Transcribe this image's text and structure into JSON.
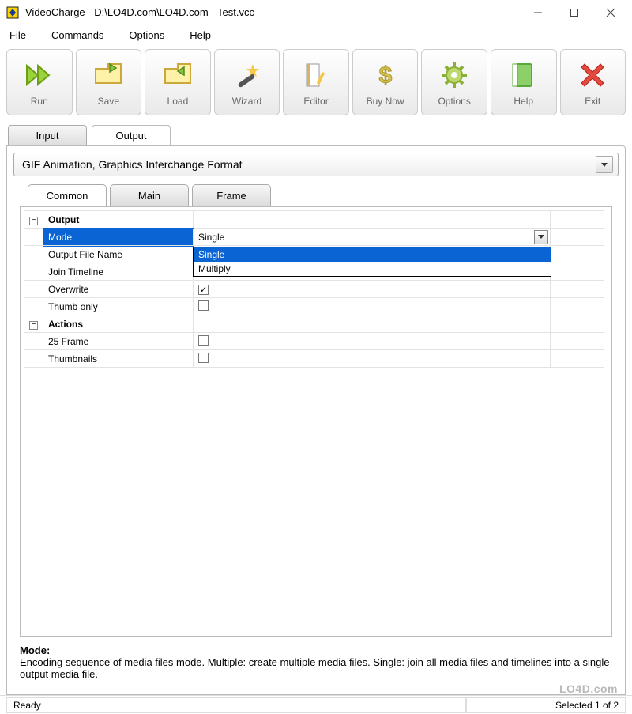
{
  "window": {
    "title": "VideoCharge - D:\\LO4D.com\\LO4D.com - Test.vcc"
  },
  "menubar": {
    "items": [
      "File",
      "Commands",
      "Options",
      "Help"
    ]
  },
  "toolbar": {
    "items": [
      {
        "name": "run",
        "label": "Run"
      },
      {
        "name": "save",
        "label": "Save"
      },
      {
        "name": "load",
        "label": "Load"
      },
      {
        "name": "wizard",
        "label": "Wizard"
      },
      {
        "name": "editor",
        "label": "Editor"
      },
      {
        "name": "buy-now",
        "label": "Buy Now"
      },
      {
        "name": "options",
        "label": "Options"
      },
      {
        "name": "help",
        "label": "Help"
      },
      {
        "name": "exit",
        "label": "Exit"
      }
    ]
  },
  "main_tabs": {
    "input": "Input",
    "output": "Output",
    "active": "output"
  },
  "format": {
    "value": "GIF Animation, Graphics Interchange Format"
  },
  "sub_tabs": {
    "common": "Common",
    "main": "Main",
    "frame": "Frame",
    "active": "common"
  },
  "grid": {
    "sections": [
      {
        "title": "Output",
        "rows": [
          {
            "key": "mode",
            "label": "Mode",
            "value": "Single",
            "type": "combo",
            "selected": true
          },
          {
            "key": "output-file-name",
            "label": "Output File Name",
            "value": "",
            "type": "text"
          },
          {
            "key": "join-timeline",
            "label": "Join Timeline",
            "value": "",
            "type": "text"
          },
          {
            "key": "overwrite",
            "label": "Overwrite",
            "checked": true,
            "type": "checkbox"
          },
          {
            "key": "thumb-only",
            "label": "Thumb only",
            "checked": false,
            "type": "checkbox"
          }
        ]
      },
      {
        "title": "Actions",
        "rows": [
          {
            "key": "25-frame",
            "label": "25 Frame",
            "checked": false,
            "type": "checkbox"
          },
          {
            "key": "thumbnails",
            "label": "Thumbnails",
            "checked": false,
            "type": "checkbox"
          }
        ]
      }
    ],
    "mode_dropdown": {
      "options": [
        "Single",
        "Multiply"
      ],
      "selected": "Single"
    }
  },
  "help": {
    "title": "Mode:",
    "text": "Encoding sequence of media files mode. Multiple: create multiple media files. Single: join all media files and timelines into a single output media file."
  },
  "statusbar": {
    "left": "Ready",
    "right": "Selected 1 of 2"
  },
  "watermark": "LO4D.com",
  "icons": {
    "minus": "−"
  }
}
